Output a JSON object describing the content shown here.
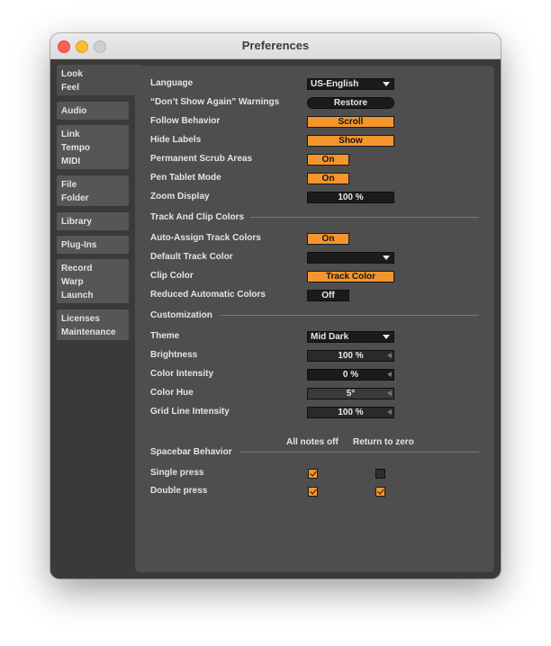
{
  "window": {
    "title": "Preferences"
  },
  "sidebar": {
    "tabs": [
      {
        "lines": [
          "Look",
          "Feel"
        ]
      },
      {
        "lines": [
          "Audio"
        ]
      },
      {
        "lines": [
          "Link",
          "Tempo",
          "MIDI"
        ]
      },
      {
        "lines": [
          "File",
          "Folder"
        ]
      },
      {
        "lines": [
          "Library"
        ]
      },
      {
        "lines": [
          "Plug-Ins"
        ]
      },
      {
        "lines": [
          "Record",
          "Warp",
          "Launch"
        ]
      },
      {
        "lines": [
          "Licenses",
          "Maintenance"
        ]
      }
    ]
  },
  "general": {
    "language": {
      "label": "Language",
      "value": "US-English"
    },
    "warnings": {
      "label": "“Don’t Show Again” Warnings",
      "button": "Restore"
    },
    "follow": {
      "label": "Follow Behavior",
      "value": "Scroll"
    },
    "hide_labels": {
      "label": "Hide Labels",
      "value": "Show"
    },
    "scrub": {
      "label": "Permanent Scrub Areas",
      "value": "On"
    },
    "pen": {
      "label": "Pen Tablet Mode",
      "value": "On"
    },
    "zoom": {
      "label": "Zoom Display",
      "value": "100 %"
    }
  },
  "track_colors": {
    "heading": "Track And Clip Colors",
    "auto_assign": {
      "label": "Auto-Assign Track Colors",
      "value": "On"
    },
    "default_color": {
      "label": "Default Track Color",
      "value": ""
    },
    "clip_color": {
      "label": "Clip Color",
      "value": "Track Color"
    },
    "reduced": {
      "label": "Reduced Automatic Colors",
      "value": "Off"
    }
  },
  "customization": {
    "heading": "Customization",
    "theme": {
      "label": "Theme",
      "value": "Mid Dark"
    },
    "brightness": {
      "label": "Brightness",
      "value": "100 %",
      "level": 1.0
    },
    "intensity": {
      "label": "Color Intensity",
      "value": "0 %",
      "level": 0.0
    },
    "hue": {
      "label": "Color Hue",
      "value": "5°",
      "level": 0.0
    },
    "grid": {
      "label": "Grid Line Intensity",
      "value": "100 %",
      "level": 1.0
    }
  },
  "spacebar": {
    "heading": "Spacebar Behavior",
    "columns": [
      "All notes off",
      "Return to zero"
    ],
    "rows": [
      {
        "label": "Single press",
        "all_notes_off": true,
        "return_to_zero": false
      },
      {
        "label": "Double press",
        "all_notes_off": true,
        "return_to_zero": true
      }
    ]
  },
  "colors": {
    "accent": "#f5952c",
    "panel": "#4e4e4e",
    "window": "#3a3a3a",
    "field": "#1b1b1b"
  }
}
